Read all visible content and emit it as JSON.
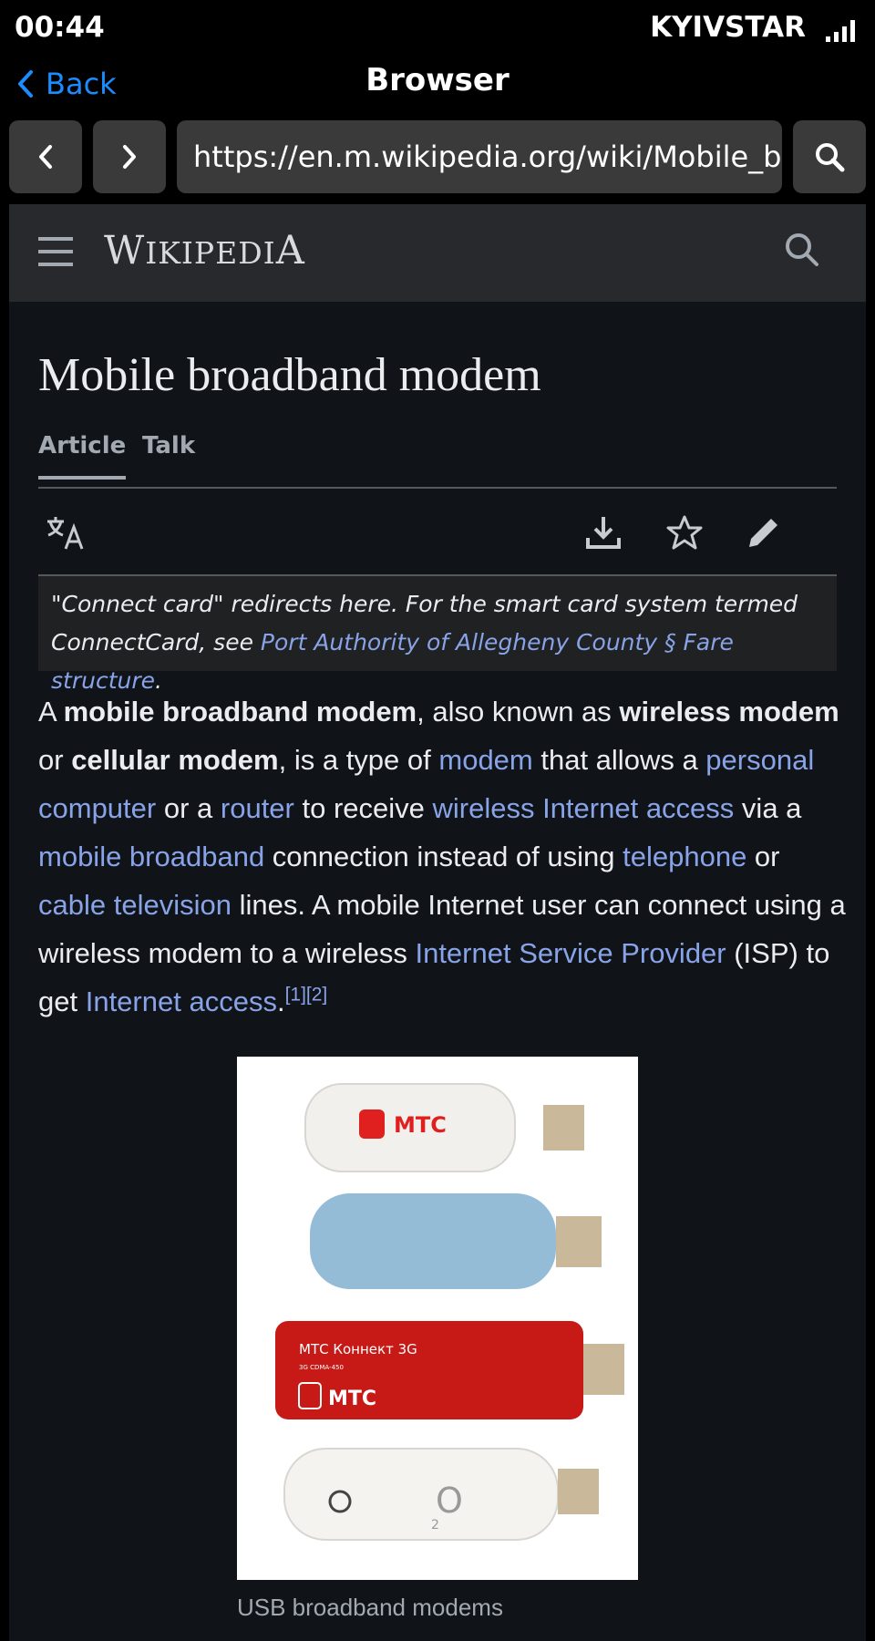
{
  "status": {
    "time": "00:44",
    "carrier": "KYIVSTAR",
    "signal_icon": "cellular-signal-icon"
  },
  "nav": {
    "back_label": "Back",
    "title": "Browser"
  },
  "toolbar": {
    "url": "https://en.m.wikipedia.org/wiki/Mobile_br"
  },
  "wiki": {
    "logo_W": "W",
    "logo_iki": "IKIPEDI",
    "logo_A": "A",
    "title": "Mobile broadband modem",
    "tabs": [
      {
        "label": "Article",
        "active": true
      },
      {
        "label": "Talk",
        "active": false
      }
    ],
    "hatnote": {
      "text": "\"Connect card\" redirects here. For the smart card system termed ConnectCard, see ",
      "link": "Port Authority of Allegheny County § Fare structure",
      "end": "."
    },
    "figure": {
      "caption": "USB broadband modems",
      "brand1": "МТС",
      "red_label": "МТС Коннект 3G",
      "red_sub": "3G CDMA-450",
      "o2": "O",
      "o2_sub": "2"
    }
  },
  "article": {
    "s1": "A ",
    "b1": "mobile broadband modem",
    "s2": ", also known as ",
    "b2": "wireless modem",
    "s3": " or ",
    "b3": "cellular modem",
    "s4": ", is a type of ",
    "l_modem": "modem",
    "s5": " that allows a ",
    "l_pc": "personal computer",
    "s6": " or a ",
    "l_router": "router",
    "s7": " to receive ",
    "l_wireless": "wireless Internet access",
    "s8": " via a ",
    "l_mbb": "mobile broadband",
    "s9": " connection instead of using ",
    "l_tel": "telephone",
    "s10": " or ",
    "l_cable": "cable television",
    "s11": " lines. A mobile Internet user can connect using a wireless modem to a wireless ",
    "l_isp": "Internet Service Provider",
    "s12": " (ISP) to get ",
    "l_access": "Internet access",
    "s13": ".",
    "ref1": "[1]",
    "ref2": "[2]"
  },
  "colors": {
    "accent": "#1a8cff",
    "link": "#88a3e8",
    "background": "#101418"
  }
}
